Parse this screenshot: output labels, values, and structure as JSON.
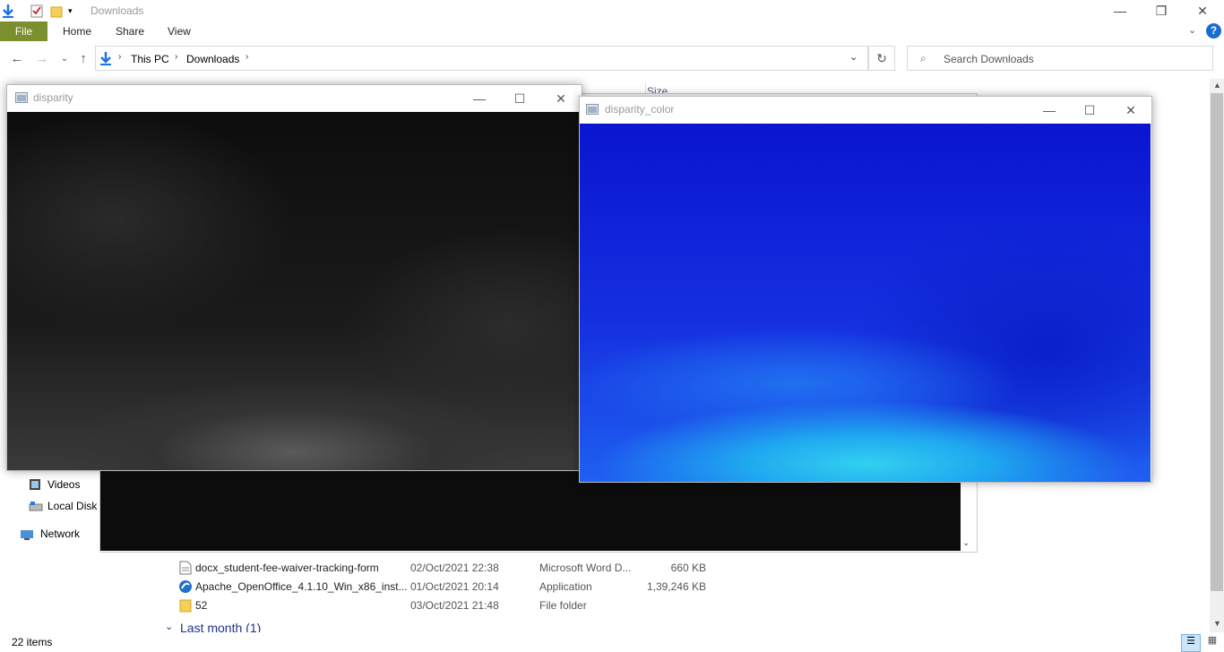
{
  "explorer": {
    "title": "Downloads",
    "ribbon_tabs": [
      "File",
      "Home",
      "Share",
      "View"
    ],
    "help_label": "?",
    "address": {
      "crumbs": [
        "This PC",
        "Downloads"
      ]
    },
    "search_placeholder": "Search Downloads",
    "column_header_partial": "Size",
    "nav_items": [
      {
        "label": "Videos",
        "icon": "video-folder-icon"
      },
      {
        "label": "Local Disk (",
        "icon": "local-disk-icon"
      },
      {
        "label": "Network",
        "icon": "network-icon"
      }
    ],
    "files": [
      {
        "name": "docx_student-fee-waiver-tracking-form",
        "date": "02/Oct/2021 22:38",
        "type": "Microsoft Word D...",
        "size": "660 KB",
        "icon": "word-document-icon"
      },
      {
        "name": "Apache_OpenOffice_4.1.10_Win_x86_inst...",
        "date": "01/Oct/2021 20:14",
        "type": "Application",
        "size": "1,39,246 KB",
        "icon": "application-icon"
      },
      {
        "name": "52",
        "date": "03/Oct/2021 21:48",
        "type": "File folder",
        "size": "",
        "icon": "folder-icon"
      }
    ],
    "group_header": "Last month (1)",
    "status": "22 items"
  },
  "windows": {
    "disparity": {
      "title": "disparity"
    },
    "disparity_color": {
      "title": "disparity_color"
    }
  },
  "colors": {
    "file_tab": "#7b8f2e",
    "group_header": "#1e3287",
    "help": "#1a6bd0"
  }
}
